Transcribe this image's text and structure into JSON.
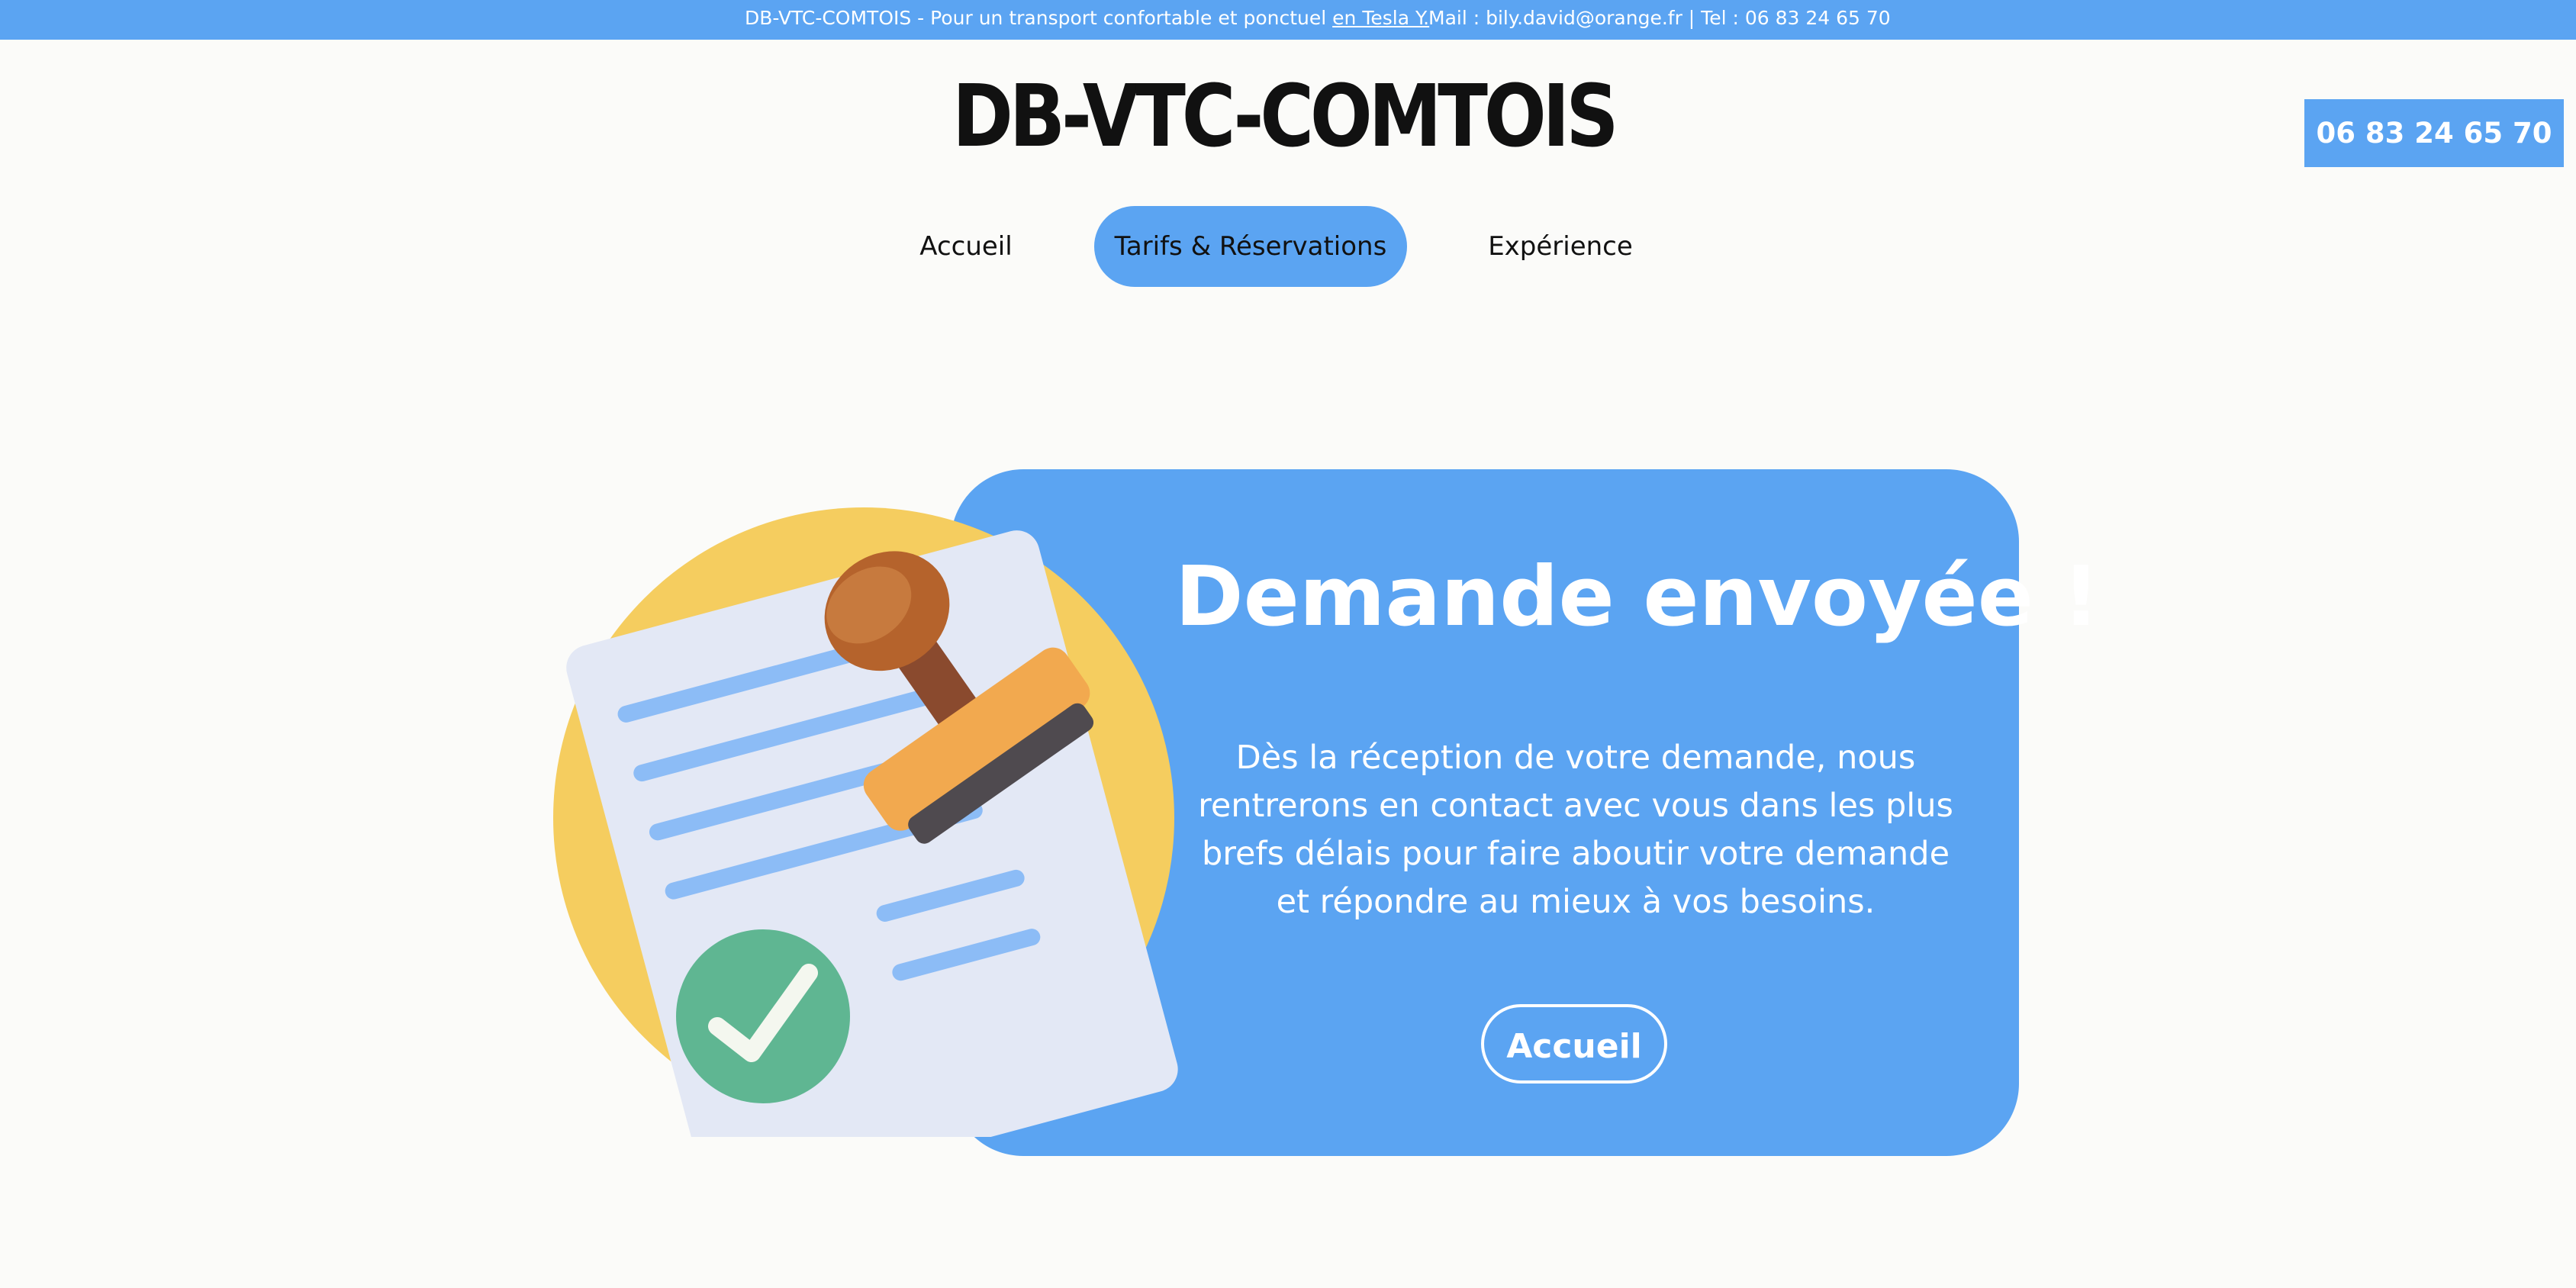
{
  "topbar": {
    "promo_text": "DB-VTC-COMTOIS - Pour un transport confortable et ponctuel ",
    "promo_link": "en Tesla Y.",
    "contact": "Mail : bily.david@orange.fr | Tel : 06 83 24 65 70"
  },
  "header": {
    "logo": "DB-VTC-COMTOIS",
    "phone": "06 83 24 65 70"
  },
  "nav": {
    "items": [
      {
        "label": "Accueil",
        "active": false
      },
      {
        "label": "Tarifs & Réservations",
        "active": true
      },
      {
        "label": "Expérience",
        "active": false
      }
    ]
  },
  "confirmation": {
    "title": "Demande envoyée !",
    "message": "Dès la réception de votre demande, nous rentrerons en contact avec vous dans les plus brefs délais pour faire aboutir votre demande et répondre au mieux à vos besoins.",
    "button": "Accueil"
  },
  "colors": {
    "accent": "#5ba4f2",
    "illustration_circle": "#f5cd5f",
    "document": "#e3e8f5",
    "document_lines": "#8cbcf6",
    "check_badge": "#5fb692",
    "stamp_handle": "#b5632c",
    "stamp_base": "#f2a94f"
  },
  "icons": {
    "illustration": "document-stamp-approved-icon"
  }
}
